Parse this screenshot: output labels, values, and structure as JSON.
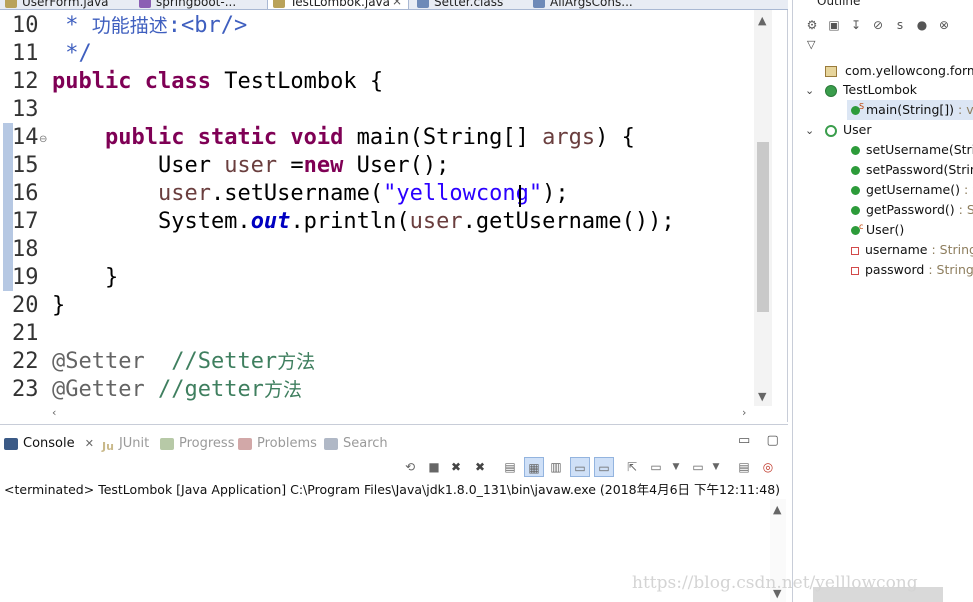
{
  "editor_tabs": [
    {
      "label": "UserForm.java",
      "icon_color": "#b9a25a"
    },
    {
      "label": "springboot-...",
      "icon_color": "#8b5fb4"
    },
    {
      "label": "TestLombok.java",
      "icon_color": "#b9a25a"
    },
    {
      "label": "Setter.class",
      "icon_color": "#6e8ab8"
    },
    {
      "label": "AllArgsCons...",
      "icon_color": "#6e8ab8"
    }
  ],
  "tab_close_glyph": "×",
  "code_lines": [
    {
      "n": "10",
      "segs": [
        {
          "t": " * ",
          "c": "dc"
        },
        {
          "t": "功能描述",
          "c": "dc cjk"
        },
        {
          "t": ":<br/>",
          "c": "dc"
        }
      ]
    },
    {
      "n": "11",
      "segs": [
        {
          "t": " */",
          "c": "dc"
        }
      ]
    },
    {
      "n": "12",
      "segs": [
        {
          "t": "public class",
          "c": "kw"
        },
        {
          "t": " TestLombok {",
          "c": ""
        }
      ]
    },
    {
      "n": "13",
      "segs": []
    },
    {
      "n": "14",
      "segs": [
        {
          "t": "    ",
          "c": ""
        },
        {
          "t": "public static void",
          "c": "kw"
        },
        {
          "t": " main(String[] ",
          "c": ""
        },
        {
          "t": "args",
          "c": "var"
        },
        {
          "t": ") {",
          "c": ""
        }
      ]
    },
    {
      "n": "15",
      "segs": [
        {
          "t": "        User ",
          "c": ""
        },
        {
          "t": "user",
          "c": "var"
        },
        {
          "t": " =",
          "c": ""
        },
        {
          "t": "new",
          "c": "kw"
        },
        {
          "t": " User();",
          "c": ""
        }
      ]
    },
    {
      "n": "16",
      "segs": [
        {
          "t": "        ",
          "c": ""
        },
        {
          "t": "user",
          "c": "var"
        },
        {
          "t": ".setUsername(",
          "c": ""
        },
        {
          "t": "\"yellowcong\"",
          "c": "st"
        },
        {
          "t": ");",
          "c": ""
        }
      ]
    },
    {
      "n": "17",
      "segs": [
        {
          "t": "        System.",
          "c": ""
        },
        {
          "t": "out",
          "c": "fld"
        },
        {
          "t": ".println(",
          "c": ""
        },
        {
          "t": "user",
          "c": "var"
        },
        {
          "t": ".getUsername());",
          "c": ""
        }
      ]
    },
    {
      "n": "18",
      "segs": []
    },
    {
      "n": "19",
      "segs": [
        {
          "t": "    }",
          "c": ""
        }
      ]
    },
    {
      "n": "20",
      "segs": [
        {
          "t": "}",
          "c": ""
        }
      ]
    },
    {
      "n": "21",
      "segs": []
    },
    {
      "n": "22",
      "segs": [
        {
          "t": "@Setter",
          "c": "ann"
        },
        {
          "t": "  ",
          "c": ""
        },
        {
          "t": "//Setter",
          "c": "cm"
        },
        {
          "t": "方法",
          "c": "cm cjk"
        }
      ]
    },
    {
      "n": "23",
      "segs": [
        {
          "t": "@Getter",
          "c": "ann"
        },
        {
          "t": " ",
          "c": ""
        },
        {
          "t": "//getter",
          "c": "cm"
        },
        {
          "t": "方法",
          "c": "cm cjk"
        }
      ]
    }
  ],
  "outline": {
    "title": "Outline",
    "package": "com.yellowcong.form",
    "classes": [
      {
        "name": "TestLombok",
        "members": [
          {
            "kind": "method",
            "label": "main(String[])",
            "type": " : void",
            "static": true,
            "selected": true
          }
        ]
      },
      {
        "name": "User",
        "members": [
          {
            "kind": "method",
            "label": "setUsername(String)",
            "type": ""
          },
          {
            "kind": "method",
            "label": "setPassword(String)",
            "type": ""
          },
          {
            "kind": "method",
            "label": "getUsername()",
            "type": " : String"
          },
          {
            "kind": "method",
            "label": "getPassword()",
            "type": " : String"
          },
          {
            "kind": "constructor",
            "label": "User()",
            "type": ""
          },
          {
            "kind": "field",
            "label": "username",
            "type": " : String"
          },
          {
            "kind": "field",
            "label": "password",
            "type": " : String"
          }
        ]
      }
    ]
  },
  "console_tabs": [
    {
      "label": "Console",
      "active": true,
      "icon_color": "#3b5a86",
      "close": "✕"
    },
    {
      "label": "JUnit",
      "active": false,
      "icon_color": "#c9b98a",
      "icon_text": "Ju"
    },
    {
      "label": "Progress",
      "active": false,
      "icon_color": "#b7c9a7"
    },
    {
      "label": "Problems",
      "active": false,
      "icon_color": "#d2a8a8"
    },
    {
      "label": "Search",
      "active": false,
      "icon_color": "#b0b8c6"
    }
  ],
  "console_status": "<terminated> TestLombok [Java Application] C:\\Program Files\\Java\\jdk1.8.0_131\\bin\\javaw.exe (2018年4月6日 下午12:11:48)",
  "watermark": "https://blog.csdn.net/yelllowcong",
  "window_buttons": {
    "minimize": "▭",
    "maximize": "▢"
  }
}
